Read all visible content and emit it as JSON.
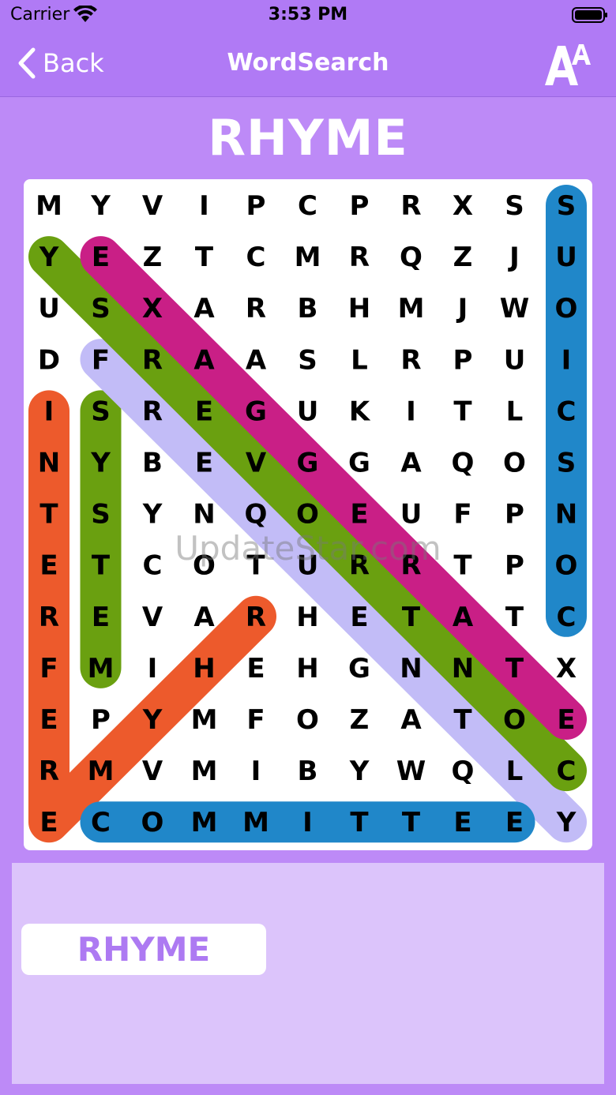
{
  "status_bar": {
    "carrier": "Carrier",
    "time": "3:53 PM"
  },
  "nav": {
    "back_label": "Back",
    "title": "WordSearch",
    "font_icon": "font-size-icon"
  },
  "puzzle": {
    "title": "RHYME",
    "grid": [
      "MYVIPCPRXSS",
      "YEZTCMRQZJU",
      "USXARBHMJWO",
      "DFRAASLRPUI",
      "ISREGUKITLC",
      "NYBEVGGAQOS",
      "TSYNQOEUFPN",
      "ETCOTURRTPO",
      "REVARHETATC",
      "FMIHEHGNNTX",
      "EPYMFOZATOE",
      "RMVMIBYWQLC",
      "ECOMMITTEEY"
    ],
    "found_words": [
      {
        "color": "#ed5a2c",
        "cells": [
          [
            4,
            0
          ],
          [
            12,
            0
          ],
          [
            8,
            4
          ]
        ]
      },
      {
        "color": "#6aa010",
        "cells": [
          [
            4,
            1
          ],
          [
            9,
            1
          ]
        ]
      },
      {
        "color": "#c2bcf7",
        "cells": [
          [
            3,
            1
          ],
          [
            12,
            10
          ]
        ]
      },
      {
        "color": "#6aa010",
        "cells": [
          [
            1,
            0
          ],
          [
            11,
            10
          ]
        ]
      },
      {
        "color": "#c91f86",
        "cells": [
          [
            1,
            1
          ],
          [
            10,
            10
          ]
        ]
      },
      {
        "color": "#2087c9",
        "cells": [
          [
            0,
            10
          ],
          [
            8,
            10
          ]
        ]
      },
      {
        "color": "#2087c9",
        "cells": [
          [
            12,
            1
          ],
          [
            12,
            9
          ]
        ]
      }
    ]
  },
  "watermark": "UpdateStar.com",
  "word_list": [
    "RHYME"
  ]
}
